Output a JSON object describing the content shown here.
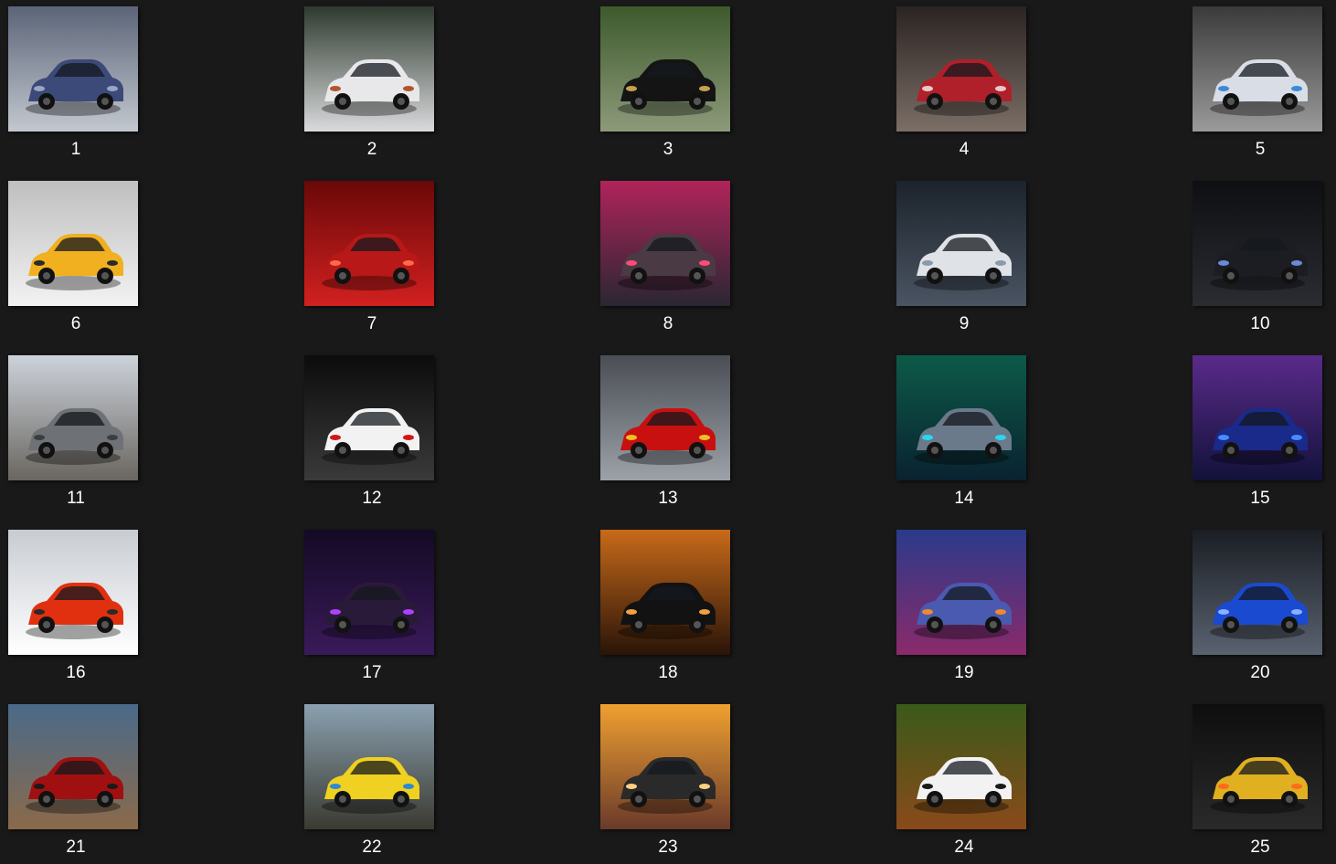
{
  "gallery": {
    "items": [
      {
        "label": "1",
        "bg": [
          "#5b6478",
          "#c3c8cf"
        ],
        "body": "#3b4a78",
        "accent": "#9aa6c4",
        "icon": "car-photo-thumbnail-icon"
      },
      {
        "label": "2",
        "bg": [
          "#2e3a2e",
          "#d9dadc"
        ],
        "body": "#e8e8ea",
        "accent": "#b0562c",
        "icon": "car-photo-thumbnail-icon"
      },
      {
        "label": "3",
        "bg": [
          "#3d5a2c",
          "#8d9a7a"
        ],
        "body": "#141414",
        "accent": "#c9a04a",
        "icon": "car-photo-thumbnail-icon"
      },
      {
        "label": "4",
        "bg": [
          "#2b2422",
          "#7b6e66"
        ],
        "body": "#b0202a",
        "accent": "#e8c9c9",
        "icon": "car-photo-thumbnail-icon"
      },
      {
        "label": "5",
        "bg": [
          "#3a3a3a",
          "#9a9a9a"
        ],
        "body": "#d8dde6",
        "accent": "#3a8ad6",
        "icon": "car-photo-thumbnail-icon"
      },
      {
        "label": "6",
        "bg": [
          "#bfbfbf",
          "#f2f2f2"
        ],
        "body": "#f0b020",
        "accent": "#2a2a2a",
        "icon": "car-photo-thumbnail-icon"
      },
      {
        "label": "7",
        "bg": [
          "#6a0808",
          "#d22020"
        ],
        "body": "#b81818",
        "accent": "#ff6a4a",
        "icon": "car-photo-thumbnail-icon"
      },
      {
        "label": "8",
        "bg": [
          "#b0245a",
          "#2a2632"
        ],
        "body": "#4a3a44",
        "accent": "#ff4a7a",
        "icon": "car-photo-thumbnail-icon"
      },
      {
        "label": "9",
        "bg": [
          "#1c232c",
          "#4a5462"
        ],
        "body": "#dfe2e6",
        "accent": "#8a9aaa",
        "icon": "car-photo-thumbnail-icon"
      },
      {
        "label": "10",
        "bg": [
          "#0e0f12",
          "#2a2c32"
        ],
        "body": "#1c1d22",
        "accent": "#6a8ad6",
        "icon": "car-photo-thumbnail-icon"
      },
      {
        "label": "11",
        "bg": [
          "#cdd3db",
          "#6a6660"
        ],
        "body": "#6e7276",
        "accent": "#3a3e42",
        "icon": "car-photo-thumbnail-icon"
      },
      {
        "label": "12",
        "bg": [
          "#0c0c0c",
          "#3a3a3a"
        ],
        "body": "#f2f2f2",
        "accent": "#d01818",
        "icon": "car-photo-thumbnail-icon"
      },
      {
        "label": "13",
        "bg": [
          "#4a4e54",
          "#9ca2a8"
        ],
        "body": "#c81010",
        "accent": "#f0c020",
        "icon": "car-photo-thumbnail-icon"
      },
      {
        "label": "14",
        "bg": [
          "#0c5a48",
          "#0a2230"
        ],
        "body": "#6a7a8a",
        "accent": "#2ad6f0",
        "icon": "car-photo-thumbnail-icon"
      },
      {
        "label": "15",
        "bg": [
          "#5a2a8a",
          "#12123a"
        ],
        "body": "#1a2a8a",
        "accent": "#4a8aff",
        "icon": "car-photo-thumbnail-icon"
      },
      {
        "label": "16",
        "bg": [
          "#c8ccd2",
          "#ffffff"
        ],
        "body": "#e03010",
        "accent": "#2a2a2a",
        "icon": "car-photo-thumbnail-icon"
      },
      {
        "label": "17",
        "bg": [
          "#140a24",
          "#3a1a5a"
        ],
        "body": "#2a1a3a",
        "accent": "#b040ff",
        "icon": "car-photo-thumbnail-icon"
      },
      {
        "label": "18",
        "bg": [
          "#c86a1a",
          "#2a1408"
        ],
        "body": "#121212",
        "accent": "#f0a040",
        "icon": "car-photo-thumbnail-icon"
      },
      {
        "label": "19",
        "bg": [
          "#2a3a8a",
          "#8a2a6a"
        ],
        "body": "#4a5ab0",
        "accent": "#f08a2a",
        "icon": "car-photo-thumbnail-icon"
      },
      {
        "label": "20",
        "bg": [
          "#1a1e24",
          "#5a6270"
        ],
        "body": "#1a4ad0",
        "accent": "#8ab0ff",
        "icon": "car-photo-thumbnail-icon"
      },
      {
        "label": "21",
        "bg": [
          "#4a6a8a",
          "#8a6a4a"
        ],
        "body": "#a01010",
        "accent": "#1a1a1a",
        "icon": "car-photo-thumbnail-icon"
      },
      {
        "label": "22",
        "bg": [
          "#8aa0b0",
          "#3a3a30"
        ],
        "body": "#f0d020",
        "accent": "#2a8ad6",
        "icon": "car-photo-thumbnail-icon"
      },
      {
        "label": "23",
        "bg": [
          "#f0a030",
          "#6a3a2a"
        ],
        "body": "#2a2a2a",
        "accent": "#ffd080",
        "icon": "car-photo-thumbnail-icon"
      },
      {
        "label": "24",
        "bg": [
          "#3a5a1a",
          "#8a4a1a"
        ],
        "body": "#f2f2f2",
        "accent": "#1a1a1a",
        "icon": "car-photo-thumbnail-icon"
      },
      {
        "label": "25",
        "bg": [
          "#0e0e0e",
          "#2a2a2a"
        ],
        "body": "#e0b020",
        "accent": "#ff6a1a",
        "icon": "car-photo-thumbnail-icon"
      }
    ]
  }
}
